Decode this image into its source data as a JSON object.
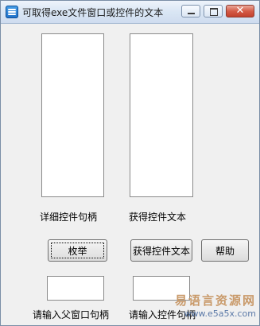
{
  "window": {
    "title": "可取得exe文件窗口或控件的文本",
    "icon": "app-icon",
    "min_glyph": "—",
    "max_glyph": "□",
    "close_glyph": "✕"
  },
  "labels": {
    "detail_handle": "详细控件句柄",
    "get_text": "获得控件文本",
    "enter_parent_handle": "请输入父窗口句柄",
    "enter_control_handle": "请输入控件句柄"
  },
  "buttons": {
    "enumerate": "枚举",
    "get_text": "获得控件文本",
    "help": "帮助"
  },
  "inputs": {
    "parent_handle": "",
    "control_handle": ""
  },
  "watermark": {
    "chinese": "易语言资源网",
    "url": "www.e5a5x.com"
  }
}
